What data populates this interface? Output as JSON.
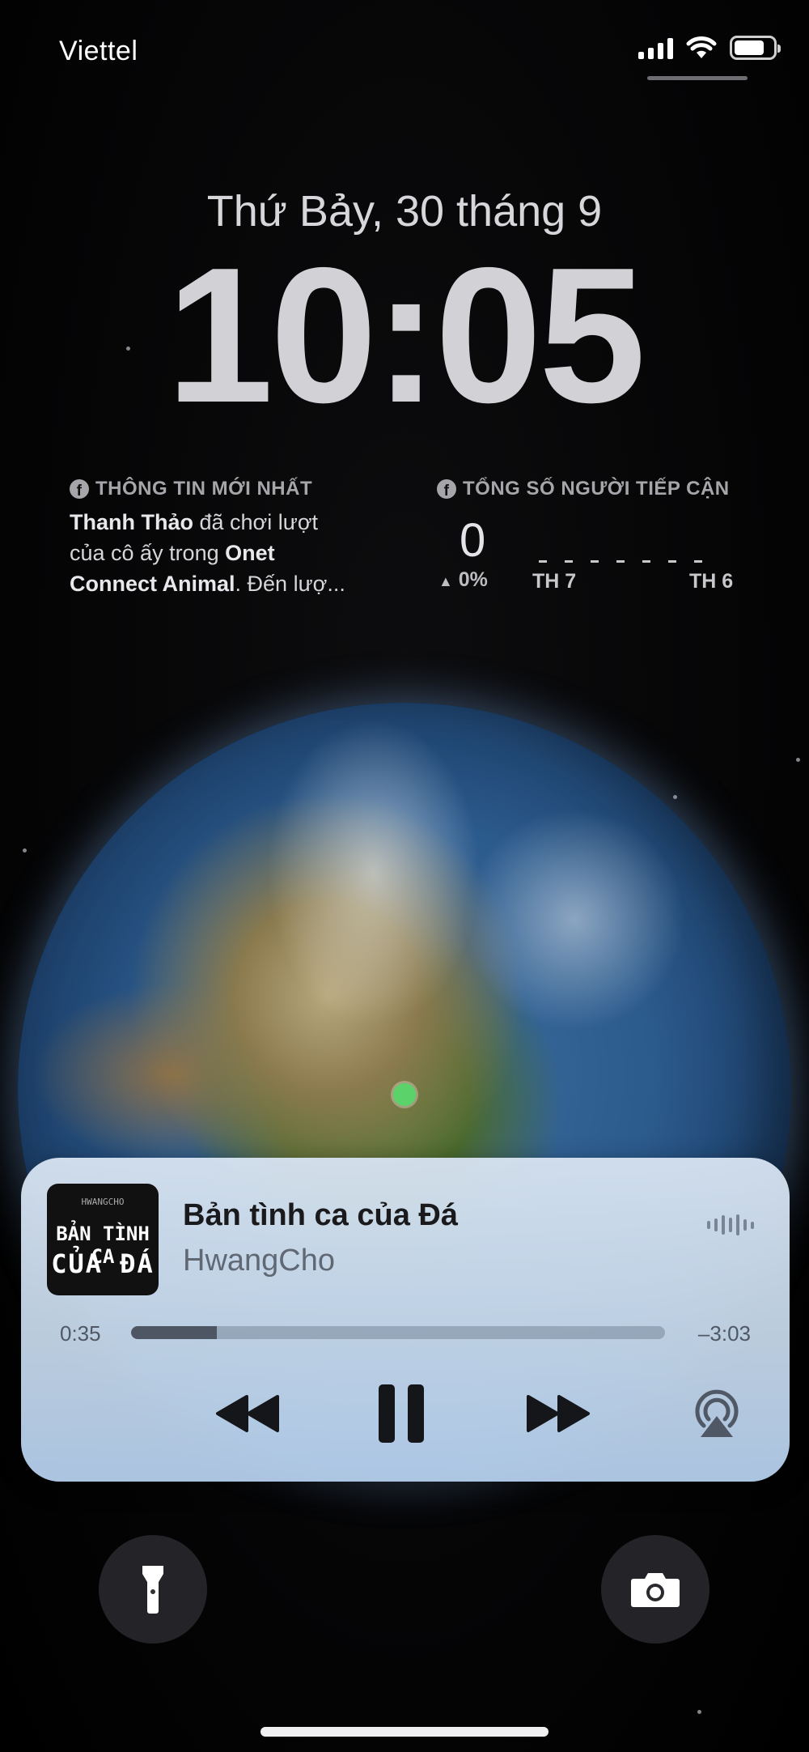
{
  "status_bar": {
    "carrier": "Viettel",
    "signal_bars": 4,
    "battery_level": 0.78
  },
  "lock_screen": {
    "date": "Thứ Bảy, 30 tháng 9",
    "time": "10:05"
  },
  "widgets": {
    "news": {
      "heading": "THÔNG TIN MỚI NHẤT",
      "icon": "facebook-icon",
      "line1_bold": "Thanh Thảo",
      "line1_rest": " đã chơi lượt",
      "line2_rest": "của cô ấy trong ",
      "line2_bold": "Onet",
      "line3_bold": "Connect Animal",
      "line3_rest": ". Đến lượ..."
    },
    "reach": {
      "heading": "TỔNG SỐ NGƯỜI TIẾP CẬN",
      "icon": "facebook-icon",
      "count": "0",
      "change": "0%",
      "day_start": "TH 7",
      "day_end": "TH 6"
    }
  },
  "player": {
    "artwork": {
      "top": "HWANGCHO",
      "line1": "BẢN TÌNH CA",
      "line2": "CỦA ĐÁ"
    },
    "title": "Bản tình ca của Đá",
    "artist": "HwangCho",
    "elapsed": "0:35",
    "remaining": "–3:03",
    "progress": 0.16,
    "controls": [
      "rewind-icon",
      "pause-icon",
      "fast-forward-icon",
      "airplay-icon"
    ]
  },
  "bottom": {
    "left": "flashlight-icon",
    "right": "camera-icon"
  },
  "colors": {
    "location_dot": "#5bd36a",
    "player_bg": "#cddcec"
  }
}
